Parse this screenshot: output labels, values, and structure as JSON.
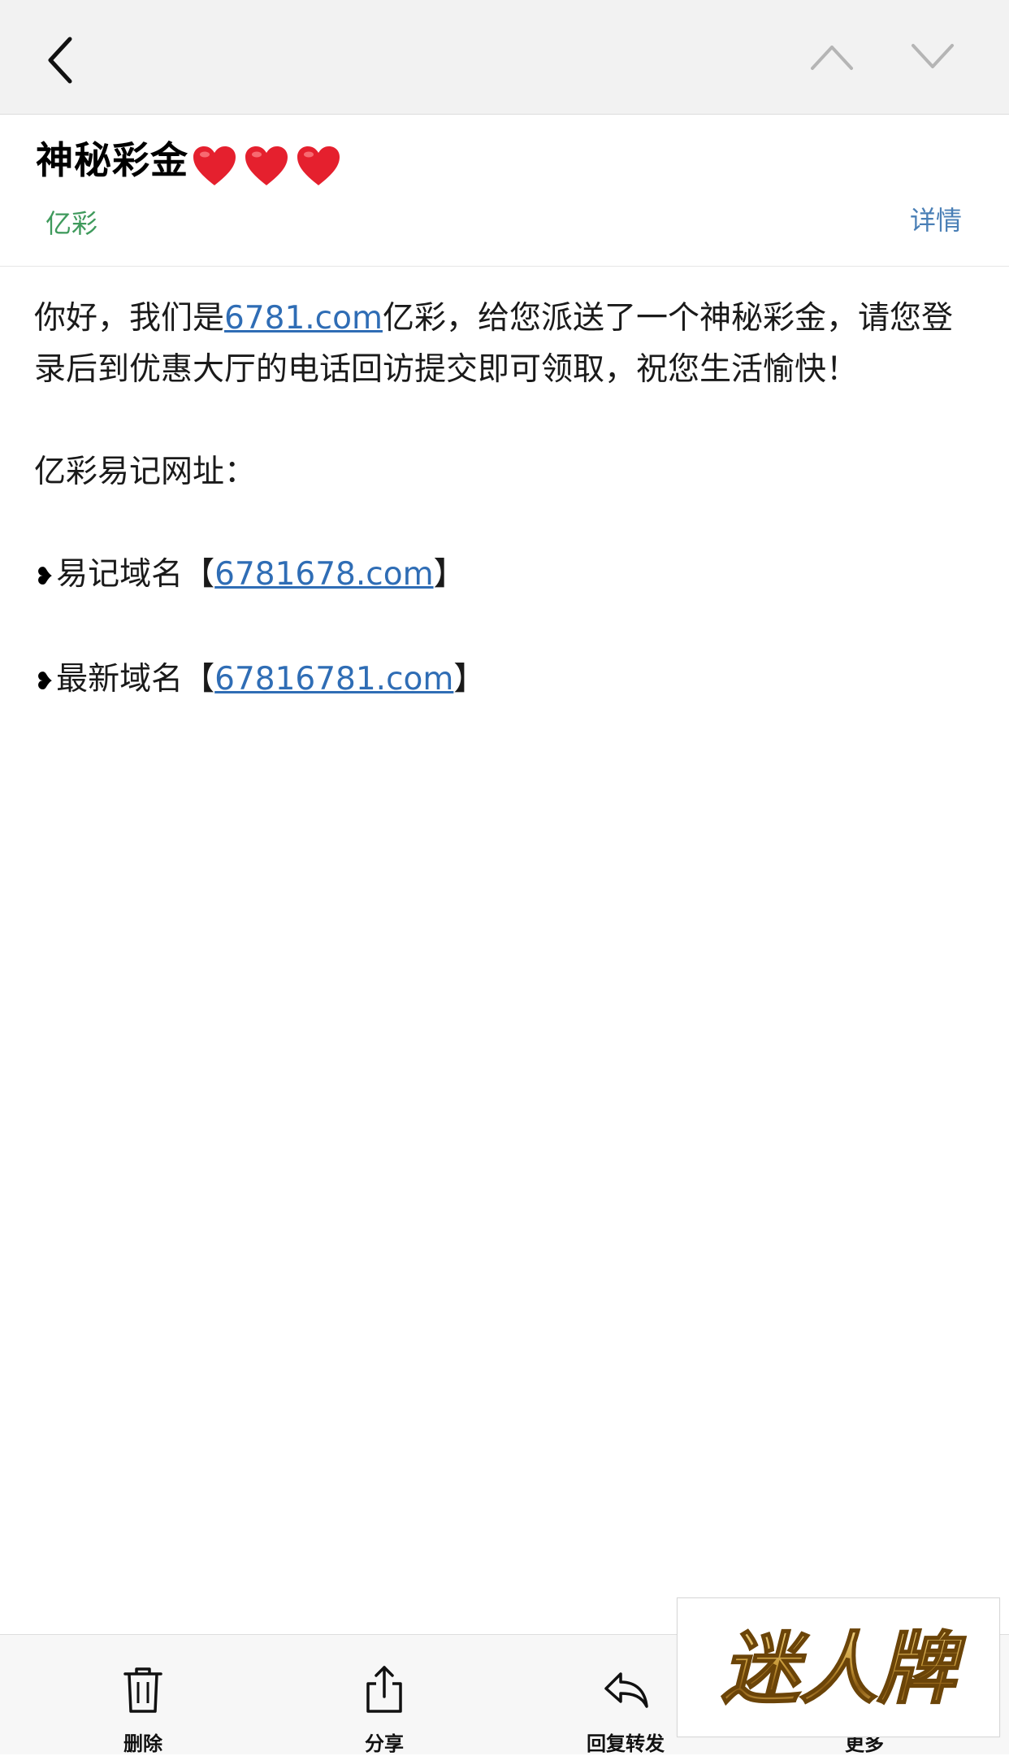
{
  "nav": {
    "back_icon": "chevron-left-icon",
    "prev_icon": "chevron-up-icon",
    "next_icon": "chevron-down-icon"
  },
  "header": {
    "subject": "神秘彩金",
    "subject_emoji": [
      "heart-icon",
      "heart-icon",
      "heart-icon"
    ],
    "sender": "亿彩",
    "details_label": "详情"
  },
  "body": {
    "line1_prefix": "你好，我们是",
    "line1_link": "6781.com",
    "line1_suffix": "亿彩，给您派送了一个神秘彩金，请您登录后到优惠大厅的电话回访提交即可领取，祝您生活愉快！",
    "url_heading": "亿彩易记网址：",
    "domains": [
      {
        "bullet": "❥",
        "label": "易记域名",
        "open": "【",
        "link": "6781678.com",
        "close": "】"
      },
      {
        "bullet": "❥",
        "label": "最新域名",
        "open": "【",
        "link": "67816781.com",
        "close": "】"
      }
    ]
  },
  "toolbar": {
    "delete_label": "删除",
    "share_label": "分享",
    "reply_label": "回复转发",
    "more_label": "更多"
  },
  "watermark": {
    "text": "迷人牌"
  },
  "colors": {
    "sender": "#3f9a5c",
    "link": "#2f6db5",
    "details": "#4a7fb6",
    "heart": "#e5202e",
    "watermark_gold": "#c89a3a"
  }
}
